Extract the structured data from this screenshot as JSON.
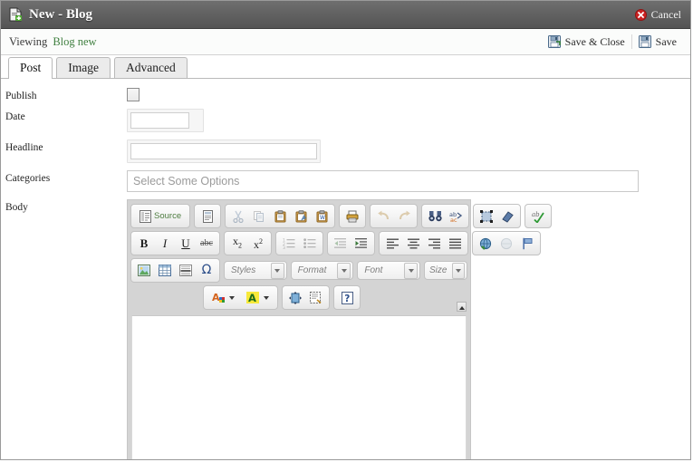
{
  "window": {
    "title": "New - Blog",
    "title_icon": "new-document-icon",
    "cancel": {
      "label": "Cancel",
      "icon": "red-x-icon"
    }
  },
  "viewbar": {
    "label": "Viewing",
    "value": "Blog new",
    "actions": [
      {
        "label": "Save & Close",
        "icon": "save-and-close-icon",
        "name": "save-and-close-button"
      },
      {
        "label": "Save",
        "icon": "save-icon",
        "name": "save-button"
      }
    ]
  },
  "tabs": [
    {
      "label": "Post",
      "active": true
    },
    {
      "label": "Image",
      "active": false
    },
    {
      "label": "Advanced",
      "active": false
    }
  ],
  "form": {
    "publish": {
      "label": "Publish",
      "checked": false
    },
    "date": {
      "label": "Date",
      "value": "",
      "placeholder": ""
    },
    "headline": {
      "label": "Headline",
      "value": "",
      "placeholder": ""
    },
    "categories": {
      "label": "Categories",
      "placeholder": "Select Some Options",
      "value": ""
    },
    "body": {
      "label": "Body",
      "value": ""
    }
  },
  "editor": {
    "toolbar_rows": [
      {
        "groups": [
          {
            "buttons": [
              {
                "name": "source-button",
                "label": "Source",
                "icon": "source-icon"
              }
            ]
          },
          {
            "buttons": [
              {
                "name": "templates-button",
                "label": "",
                "icon": "templates-icon"
              }
            ]
          },
          {
            "buttons": [
              {
                "name": "cut-button",
                "label": "",
                "icon": "scissors-icon",
                "disabled": true
              },
              {
                "name": "copy-button",
                "label": "",
                "icon": "copy-icon",
                "disabled": true
              },
              {
                "name": "paste-button",
                "label": "",
                "icon": "paste-icon"
              },
              {
                "name": "paste-text-button",
                "label": "",
                "icon": "paste-as-text-icon"
              },
              {
                "name": "paste-word-button",
                "label": "",
                "icon": "paste-from-word-icon"
              }
            ]
          },
          {
            "buttons": [
              {
                "name": "print-button",
                "label": "",
                "icon": "printer-icon"
              }
            ]
          },
          {
            "buttons": [
              {
                "name": "undo-button",
                "label": "",
                "icon": "undo-arrow-icon",
                "disabled": true
              },
              {
                "name": "redo-button",
                "label": "",
                "icon": "redo-arrow-icon",
                "disabled": true
              }
            ]
          },
          {
            "buttons": [
              {
                "name": "find-button",
                "label": "",
                "icon": "binoculars-icon"
              },
              {
                "name": "replace-button",
                "label": "",
                "icon": "replace-abc-icon"
              }
            ]
          },
          {
            "buttons": [
              {
                "name": "select-all-button",
                "label": "",
                "icon": "select-all-icon"
              },
              {
                "name": "remove-format-button",
                "label": "",
                "icon": "eraser-icon"
              }
            ]
          },
          {
            "buttons": [
              {
                "name": "spellcheck-button",
                "label": "",
                "icon": "spellcheck-icon"
              }
            ]
          }
        ]
      },
      {
        "groups": [
          {
            "buttons": [
              {
                "name": "bold-button",
                "label": "B",
                "icon": "bold-icon"
              },
              {
                "name": "italic-button",
                "label": "I",
                "icon": "italic-icon"
              },
              {
                "name": "underline-button",
                "label": "U",
                "icon": "underline-icon"
              },
              {
                "name": "strikethrough-button",
                "label": "abc",
                "icon": "strikethrough-icon"
              }
            ]
          },
          {
            "buttons": [
              {
                "name": "subscript-button",
                "label": "x2",
                "icon": "subscript-icon"
              },
              {
                "name": "superscript-button",
                "label": "x2",
                "icon": "superscript-icon"
              }
            ]
          },
          {
            "buttons": [
              {
                "name": "numbered-list-button",
                "label": "",
                "icon": "numbered-list-icon"
              },
              {
                "name": "bulleted-list-button",
                "label": "",
                "icon": "bulleted-list-icon"
              }
            ]
          },
          {
            "buttons": [
              {
                "name": "outdent-button",
                "label": "",
                "icon": "outdent-icon",
                "disabled": true
              },
              {
                "name": "indent-button",
                "label": "",
                "icon": "indent-icon"
              }
            ]
          },
          {
            "buttons": [
              {
                "name": "align-left-button",
                "label": "",
                "icon": "align-left-icon"
              },
              {
                "name": "align-center-button",
                "label": "",
                "icon": "align-center-icon"
              },
              {
                "name": "align-right-button",
                "label": "",
                "icon": "align-right-icon"
              },
              {
                "name": "align-justify-button",
                "label": "",
                "icon": "align-justify-icon"
              }
            ]
          },
          {
            "buttons": [
              {
                "name": "link-button",
                "label": "",
                "icon": "link-icon"
              },
              {
                "name": "unlink-button",
                "label": "",
                "icon": "unlink-icon",
                "disabled": true
              },
              {
                "name": "anchor-button",
                "label": "",
                "icon": "anchor-flag-icon"
              }
            ]
          }
        ]
      },
      {
        "groups": [
          {
            "buttons": [
              {
                "name": "insert-image-button",
                "label": "",
                "icon": "image-icon"
              },
              {
                "name": "insert-table-button",
                "label": "",
                "icon": "table-icon"
              },
              {
                "name": "horizontal-rule-button",
                "label": "",
                "icon": "horizontal-rule-icon"
              },
              {
                "name": "special-char-button",
                "label": "",
                "icon": "omega-icon"
              }
            ]
          }
        ],
        "combos": [
          {
            "name": "styles-select",
            "label": "Styles"
          },
          {
            "name": "format-select",
            "label": "Format"
          },
          {
            "name": "font-select",
            "label": "Font"
          },
          {
            "name": "size-select",
            "label": "Size"
          }
        ]
      },
      {
        "groups": [
          {
            "buttons": [
              {
                "name": "text-color-button",
                "label": "A",
                "icon": "text-color-icon"
              },
              {
                "name": "background-color-button",
                "label": "A",
                "icon": "background-color-icon"
              }
            ]
          },
          {
            "buttons": [
              {
                "name": "maximize-button",
                "label": "",
                "icon": "maximize-icon"
              },
              {
                "name": "show-blocks-button",
                "label": "",
                "icon": "show-blocks-icon"
              }
            ]
          },
          {
            "buttons": [
              {
                "name": "about-button",
                "label": "?",
                "icon": "help-question-icon"
              }
            ]
          }
        ]
      }
    ],
    "scroll_up": "scroll-up-arrow"
  },
  "colors": {
    "titlebar": "#616161",
    "accent_green": "#3f7f3f",
    "cancel_red": "#cc2222",
    "toolbar_bg": "#d4d4d4",
    "placeholder_gray": "#9b9b9b"
  }
}
